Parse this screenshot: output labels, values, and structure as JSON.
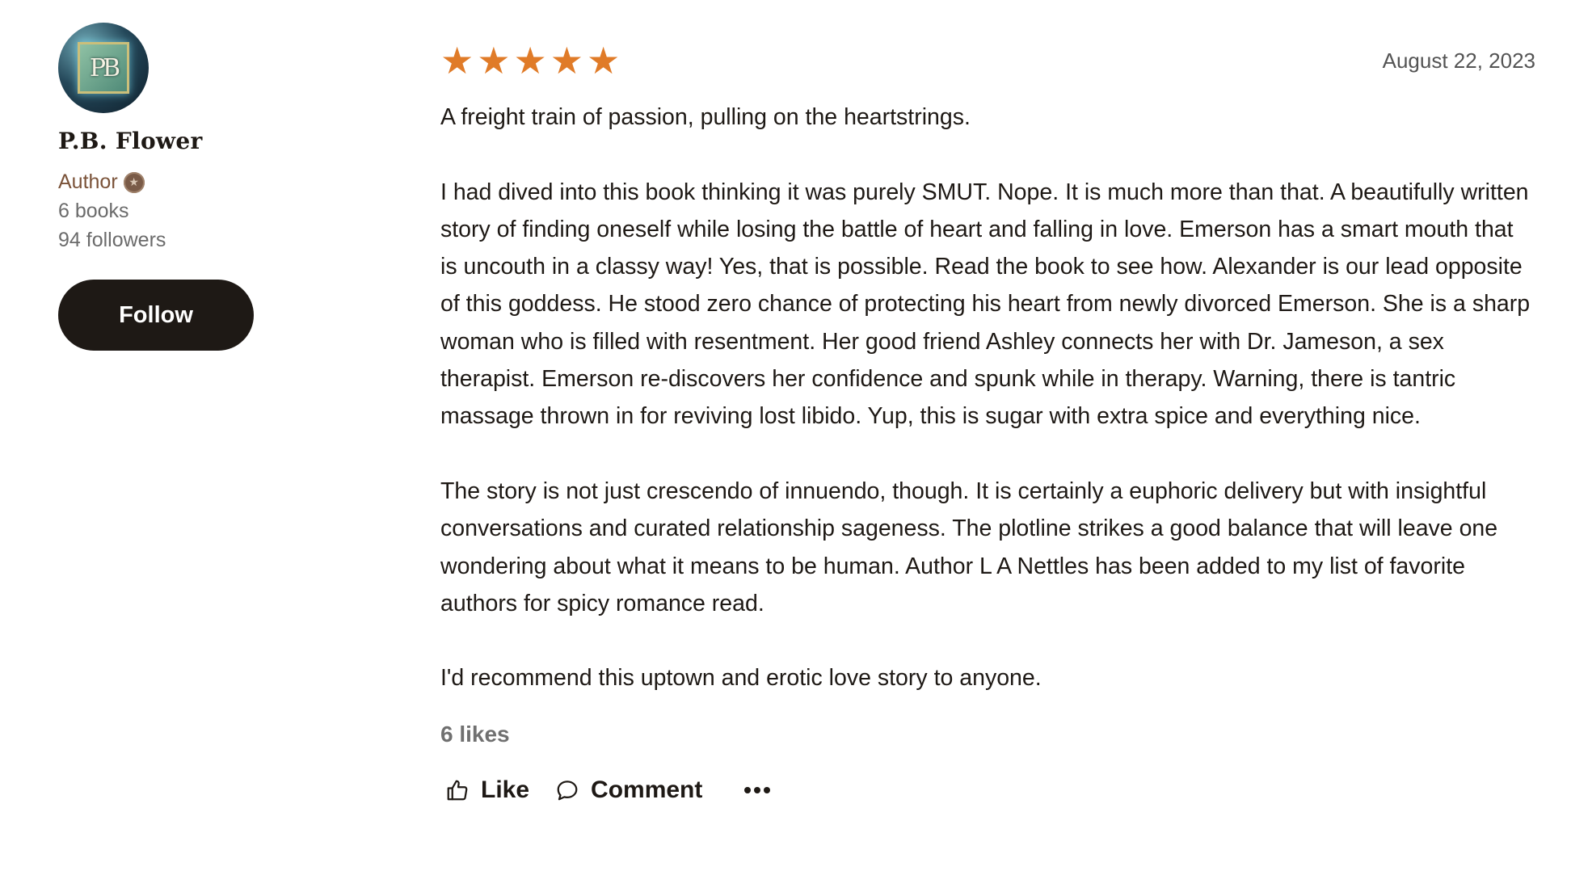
{
  "reviewer": {
    "avatar_monogram": "PB",
    "name": "P.B. Flower",
    "role": "Author",
    "books": "6 books",
    "followers": "94 followers",
    "follow_label": "Follow"
  },
  "review": {
    "rating": 5,
    "rating_max": 5,
    "star_color": "#e07b28",
    "date": "August 22, 2023",
    "paragraphs": [
      "A freight train of passion, pulling on the heartstrings.",
      "I had dived into this book thinking it was purely SMUT. Nope. It is much more than that. A beautifully written story of finding oneself while losing the battle of heart and falling in love. Emerson has a smart mouth that is uncouth in a classy way! Yes, that is possible. Read the book to see how. Alexander is our lead opposite of this goddess. He stood zero chance of protecting his heart from newly divorced Emerson. She is a sharp woman who is filled with resentment. Her good friend Ashley connects her with Dr. Jameson, a sex therapist. Emerson re-discovers her confidence and spunk while in therapy. Warning, there is tantric massage thrown in for reviving lost libido. Yup, this is sugar with extra spice and everything nice.",
      "The story is not just crescendo of innuendo, though. It is certainly a euphoric delivery but with insightful conversations and curated relationship sageness. The plotline strikes a good balance that will leave one wondering about what it means to be human. Author L A Nettles has been added to my list of favorite authors for spicy romance read.",
      "I'd recommend this uptown and erotic love story to anyone."
    ],
    "likes": "6 likes"
  },
  "actions": {
    "like_label": "Like",
    "comment_label": "Comment",
    "more_icon": "ellipsis-icon"
  }
}
